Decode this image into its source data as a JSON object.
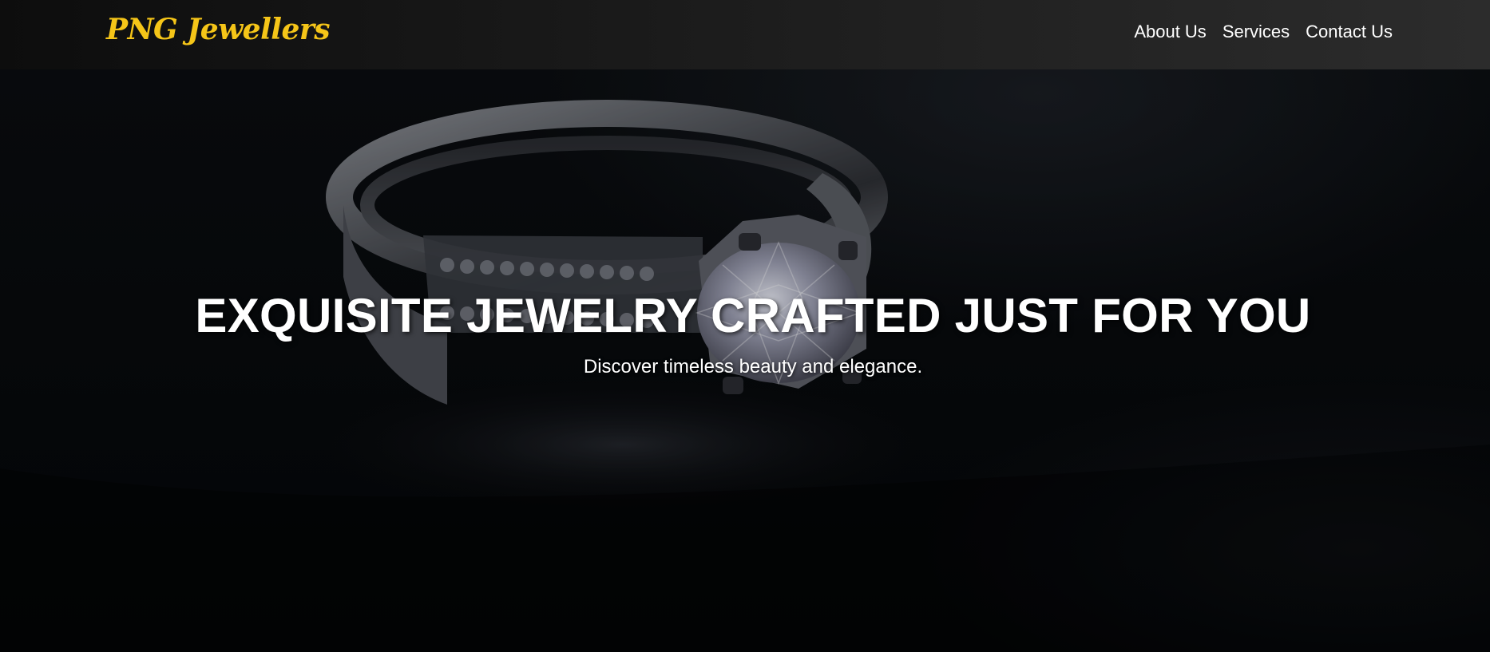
{
  "header": {
    "logo_text": "PNG Jewellers",
    "nav": [
      {
        "label": "About Us"
      },
      {
        "label": "Services"
      },
      {
        "label": "Contact Us"
      }
    ]
  },
  "hero": {
    "title": "EXQUISITE JEWELRY CRAFTED JUST FOR YOU",
    "subtitle": "Discover timeless beauty and elegance.",
    "background_image": "diamond-ring-photo"
  },
  "colors": {
    "logo": "#f5c518",
    "nav_text": "#ffffff",
    "hero_text": "#ffffff",
    "background": "#06090c"
  }
}
